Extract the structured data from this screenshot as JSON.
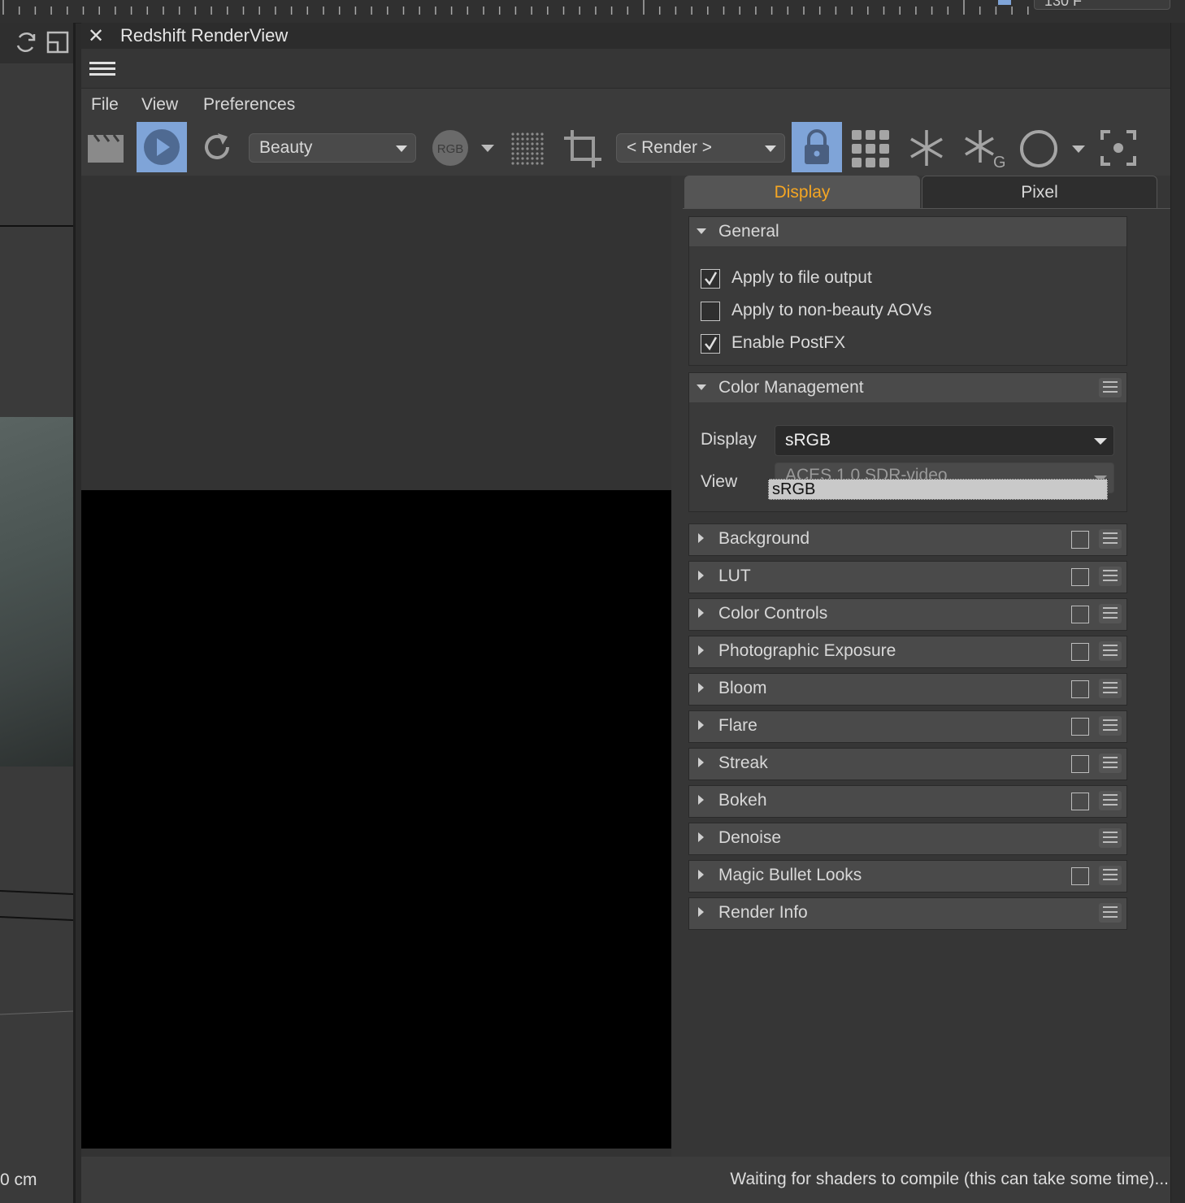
{
  "ruler": {
    "frame_field": "130 F"
  },
  "viewport": {
    "unit_label": "0 cm"
  },
  "window": {
    "title": "Redshift RenderView",
    "close_glyph": "✕"
  },
  "menu": [
    "File",
    "View",
    "Preferences"
  ],
  "toolbar": {
    "aov_selector": "Beauty",
    "channel_label": "RGB",
    "snapshot_selector": "< Render >"
  },
  "tabs": {
    "display": "Display",
    "pixel": "Pixel"
  },
  "general": {
    "title": "General",
    "options": [
      {
        "label": "Apply to file output",
        "checked": true
      },
      {
        "label": "Apply to non-beauty AOVs",
        "checked": false
      },
      {
        "label": "Enable PostFX",
        "checked": true
      }
    ]
  },
  "color_management": {
    "title": "Color Management",
    "display_label": "Display",
    "display_value": "sRGB",
    "view_label": "View",
    "view_value": "ACES 1.0 SDR-video",
    "dropdown_option": "sRGB"
  },
  "sections": [
    {
      "title": "Background",
      "has_checkbox": true
    },
    {
      "title": "LUT",
      "has_checkbox": true
    },
    {
      "title": "Color Controls",
      "has_checkbox": true
    },
    {
      "title": "Photographic Exposure",
      "has_checkbox": true
    },
    {
      "title": "Bloom",
      "has_checkbox": true
    },
    {
      "title": "Flare",
      "has_checkbox": true
    },
    {
      "title": "Streak",
      "has_checkbox": true
    },
    {
      "title": "Bokeh",
      "has_checkbox": true
    },
    {
      "title": "Denoise",
      "has_checkbox": false
    },
    {
      "title": "Magic Bullet Looks",
      "has_checkbox": true
    },
    {
      "title": "Render Info",
      "has_checkbox": false
    }
  ],
  "status": {
    "message": "Waiting for shaders to compile (this can take some time)..."
  },
  "colors": {
    "accent_tab": "#f5a623",
    "active_button": "#7fa4d8"
  },
  "icons": [
    "clapper-icon",
    "play-icon",
    "refresh-icon",
    "rgb-icon",
    "grid-dots-icon",
    "crop-icon",
    "lock-icon",
    "grid-icon",
    "snowflake-icon",
    "snowflake-g-icon",
    "circle-icon",
    "focus-icon"
  ]
}
